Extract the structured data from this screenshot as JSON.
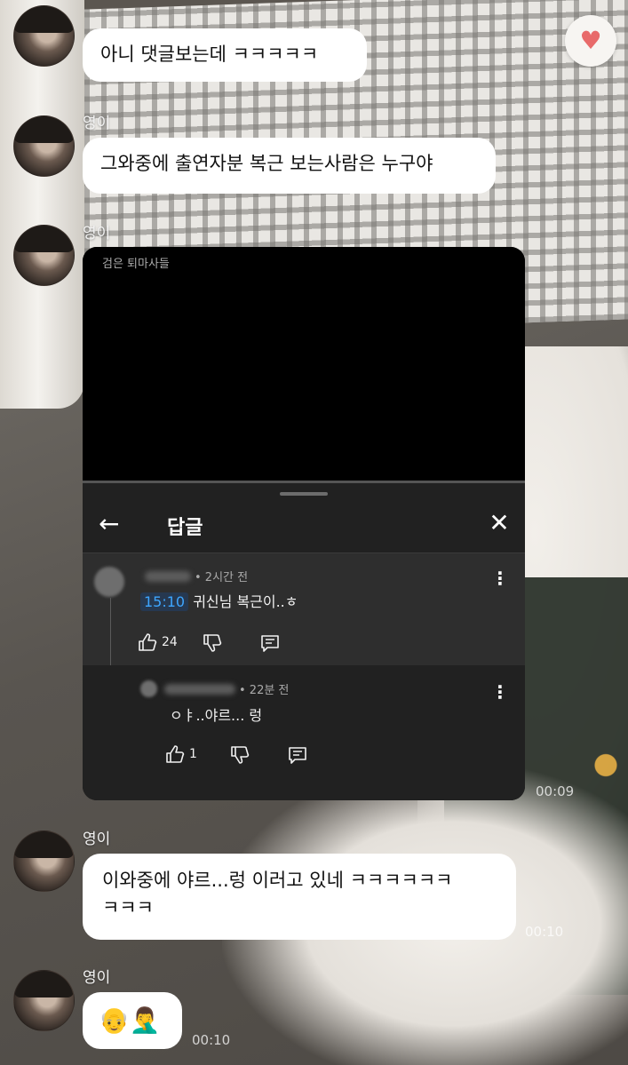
{
  "messages": [
    {
      "sender": "",
      "text": "아니 댓글보는데 ㅋㅋㅋㅋㅋ"
    },
    {
      "sender": "영이",
      "text": "그와중에 출연자분 복근 보는사람은 누구야"
    },
    {
      "sender": "영이"
    },
    {
      "sender": "영이",
      "text_line1": "이와중에 야르...렁 이러고 있네 ㅋㅋㅋㅋㅋㅋ",
      "text_line2": "ㅋㅋㅋ"
    },
    {
      "sender": "영이",
      "emoji": "👴🤦‍♂️"
    }
  ],
  "timestamps": {
    "shared_video": "00:09",
    "message_4": "00:10",
    "message_5": "00:10"
  },
  "shared_video": {
    "channel_label": "검은 퇴마사들",
    "panel_title": "답글",
    "back_icon": "←",
    "close_icon": "✕",
    "main_comment": {
      "meta": "• 2시간 전",
      "timestamp_link": "15:10",
      "text": " 귀신님 복근이..ㅎ",
      "likes": "24"
    },
    "reply_comment": {
      "meta": "• 22분 전",
      "text": "ㅇㅑ..야르... 렁",
      "likes": "1"
    }
  },
  "colors": {
    "bubble": "#ffffff",
    "timestamp_link": "#3ea6ff",
    "panel": "#212121",
    "highlight": "#2e2e2e"
  },
  "icons": [
    "heart-sticker-icon",
    "back-arrow-icon",
    "close-icon",
    "thumbs-up-icon",
    "thumbs-down-icon",
    "reply-icon",
    "more-vert-icon"
  ]
}
